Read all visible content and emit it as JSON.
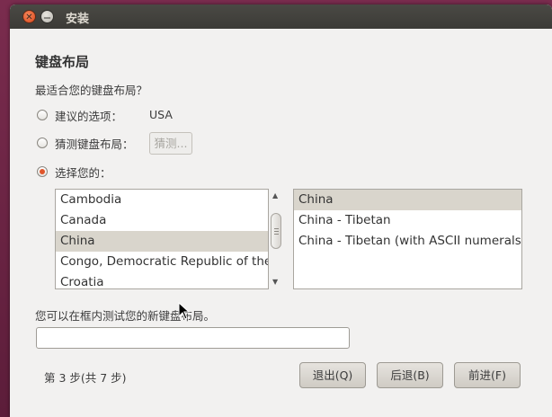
{
  "window": {
    "title": "安装",
    "close_glyph": "✕",
    "minimize_glyph": "—"
  },
  "page": {
    "heading": "键盘布局",
    "question": "最适合您的键盘布局？"
  },
  "options": {
    "suggested_label": "建议的选项：",
    "suggested_value": "USA",
    "guess_label": "猜测键盘布局：",
    "guess_button": "猜测...",
    "choose_label": "选择您的：",
    "selected_option": "choose"
  },
  "layouts": {
    "items": [
      "Cambodia",
      "Canada",
      "China",
      "Congo, Democratic Republic of the",
      "Croatia"
    ],
    "selected": "China"
  },
  "variants": {
    "items": [
      "China",
      "China - Tibetan",
      "China - Tibetan (with ASCII numerals)"
    ],
    "selected": "China"
  },
  "test": {
    "label": "您可以在框内测试您的新键盘布局。",
    "value": ""
  },
  "footer": {
    "step": "第 3 步(共 7 步)",
    "quit": "退出(Q)",
    "back": "后退(B)",
    "forward": "前进(F)"
  },
  "colors": {
    "accent": "#e0552a",
    "selection": "#d9d5cc",
    "titlebar": "#3c3b37"
  }
}
